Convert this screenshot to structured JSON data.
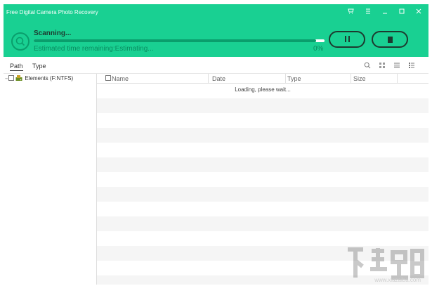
{
  "window": {
    "title": "Free Digital Camera Photo Recovery",
    "controls": [
      "cart",
      "menu",
      "minimize",
      "maximize",
      "close"
    ]
  },
  "scan": {
    "status": "Scanning...",
    "eta_text": "Estimated time remaining:Estimating...",
    "percent_text": "0%",
    "progress": 0.97
  },
  "tabs": [
    {
      "label": "Path",
      "active": true
    },
    {
      "label": "Type",
      "active": false
    }
  ],
  "tree": {
    "root_label": "Elements (F:NTFS)"
  },
  "list": {
    "columns": [
      "Name",
      "Date",
      "Type",
      "Size"
    ],
    "loading_text": "Loading, please wait..."
  },
  "watermark": {
    "url": "www.xiazaiba.com"
  },
  "colors": {
    "accent": "#19d092",
    "accent_dark": "#0a9e6c"
  }
}
